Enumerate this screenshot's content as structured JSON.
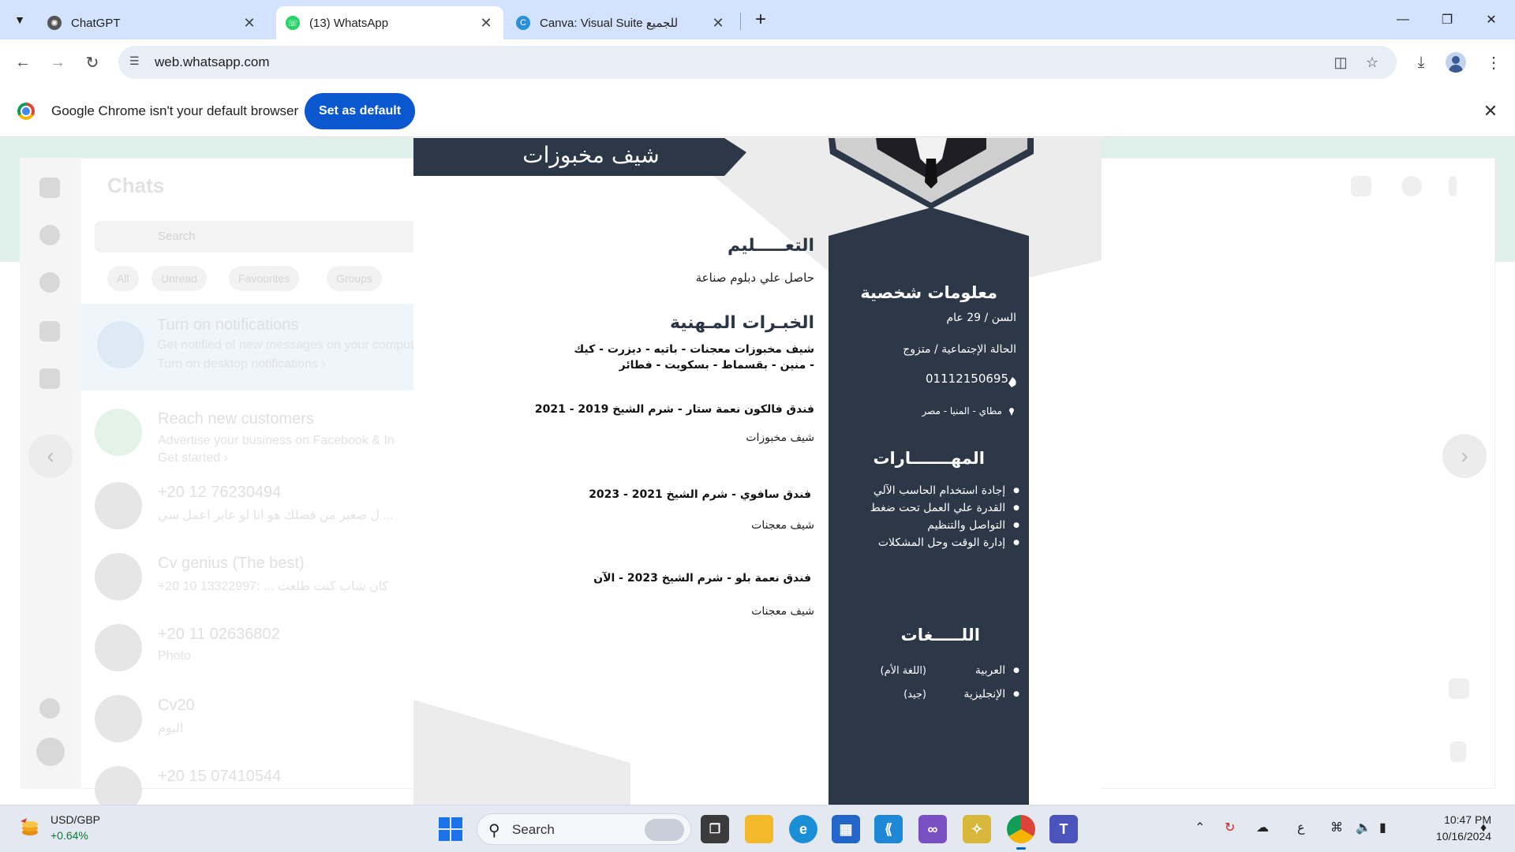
{
  "browser": {
    "tabs": [
      {
        "title": "ChatGPT",
        "icon": "chatgpt-icon",
        "active": false
      },
      {
        "title": "(13) WhatsApp",
        "icon": "whatsapp-icon",
        "active": true
      },
      {
        "title": "Canva: Visual Suite للجميع",
        "icon": "canva-icon",
        "active": false
      }
    ],
    "url": "web.whatsapp.com",
    "infobar": {
      "message": "Google Chrome isn't your default browser",
      "button": "Set as default"
    }
  },
  "whatsapp": {
    "title": "Chats",
    "search_placeholder": "Search",
    "filters": [
      "All",
      "Unread",
      "Favourites",
      "Groups"
    ],
    "notification": {
      "title": "Turn on notifications",
      "text": "Get notified of new messages on your computer.",
      "link": "Turn on desktop notifications ›"
    },
    "chats": [
      {
        "name": "Reach new customers",
        "preview": "Advertise your business on Facebook & In",
        "extra": "Get started ›"
      },
      {
        "name": "+20 12 76230494",
        "preview": "ل صغير من فضلك هو انا لو عاير اعمل سي ..."
      },
      {
        "name": "Cv genius (The best)",
        "preview": "+20 10 13322997: ... كان شاب كنت طلعت"
      },
      {
        "name": "+20 11 02636802",
        "preview": "Photo"
      },
      {
        "name": "Cv20",
        "preview": "اليوم"
      },
      {
        "name": "+20 15 07410544",
        "preview": ""
      }
    ],
    "unread_badge": "13"
  },
  "cv": {
    "job_title": "شيف مخبوزات",
    "education": {
      "heading": "التعـــــليم",
      "text": "حاصل علي دبلوم صناعة"
    },
    "experience": {
      "heading": "الخبـرات المـهنية",
      "summary_line1": "شيف مخبوزات معجنات - باتيه - ديزرت - كيك",
      "summary_line2": "- منين - بقسماط - بسكويت - فطائر",
      "jobs": [
        {
          "place": "فندق فالكون نعمة ستار - شرم الشيخ 2019 - 2021",
          "role": "شيف مخبوزات"
        },
        {
          "place": "فندق سافوي - شرم الشيخ  2021 - 2023",
          "role": "شيف معجنات"
        },
        {
          "place": "فندق نعمة بلو - شرم الشيخ  2023 - الآن",
          "role": "شيف معجنات"
        }
      ]
    },
    "personal": {
      "heading": "معلومات شخصية",
      "age": "السن /  29 عام",
      "marital": "الحالة الإجتماعية  /  متزوج",
      "phone": "01112150695",
      "address": "مطاي - المنيا - مصر"
    },
    "skills": {
      "heading": "المهـــــــارات",
      "items": [
        "إجادة استخدام الحاسب الآلي",
        "القدرة علي العمل تحت ضغط",
        "التواصل والتنظيم",
        "إدارة الوقت وحل المشكلات"
      ]
    },
    "languages": {
      "heading": "اللـــــغات",
      "items": [
        {
          "name": "العربية",
          "level": "(اللغة الأم)"
        },
        {
          "name": "الإنجليزية",
          "level": "(جيد)"
        }
      ]
    },
    "colors": {
      "navy": "#2c3748",
      "grey": "#ececec"
    }
  },
  "taskbar": {
    "ticker_name": "USD/GBP",
    "ticker_change": "+0.64%",
    "search_placeholder": "Search",
    "keyboard_lang": "ع",
    "time": "10:47 PM",
    "date": "10/16/2024"
  }
}
